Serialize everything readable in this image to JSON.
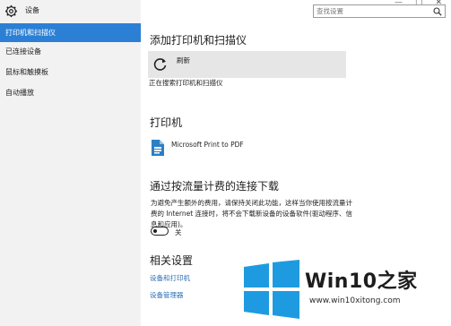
{
  "app": {
    "title": "设备"
  },
  "window": {
    "minimize": "—",
    "maximize": "□",
    "close": "✕"
  },
  "search": {
    "placeholder": "查找设置"
  },
  "sidebar": {
    "items": [
      {
        "label": "打印机和扫描仪",
        "active": true
      },
      {
        "label": "已连接设备"
      },
      {
        "label": "鼠标和触摸板"
      },
      {
        "label": "自动播放"
      }
    ]
  },
  "main": {
    "add_section": {
      "title": "添加打印机和扫描仪",
      "refresh_label": "刷新",
      "status": "正在搜索打印机和扫描仪"
    },
    "printers_section": {
      "title": "打印机",
      "printers": [
        {
          "name": "Microsoft Print to PDF"
        }
      ]
    },
    "metered_section": {
      "title": "通过按流量计费的连接下载",
      "description": "为避免产生额外的费用，请保持关闭此功能，这样当你使用按流量计费的 Internet 连接时，将不会下载新设备的设备软件(驱动程序、信息和应用)。",
      "toggle_state": "关",
      "toggle_on": false
    },
    "related_section": {
      "title": "相关设置",
      "links": [
        "设备和打印机",
        "设备管理器"
      ]
    }
  },
  "watermark": {
    "text": "Win10之家",
    "url": "www.win10xitong.com",
    "colors": {
      "blue": "#1e9be0"
    }
  },
  "colors": {
    "accent": "#2b80d5",
    "sidebar_bg": "#f2f2f2",
    "link": "#2b6fb5"
  }
}
